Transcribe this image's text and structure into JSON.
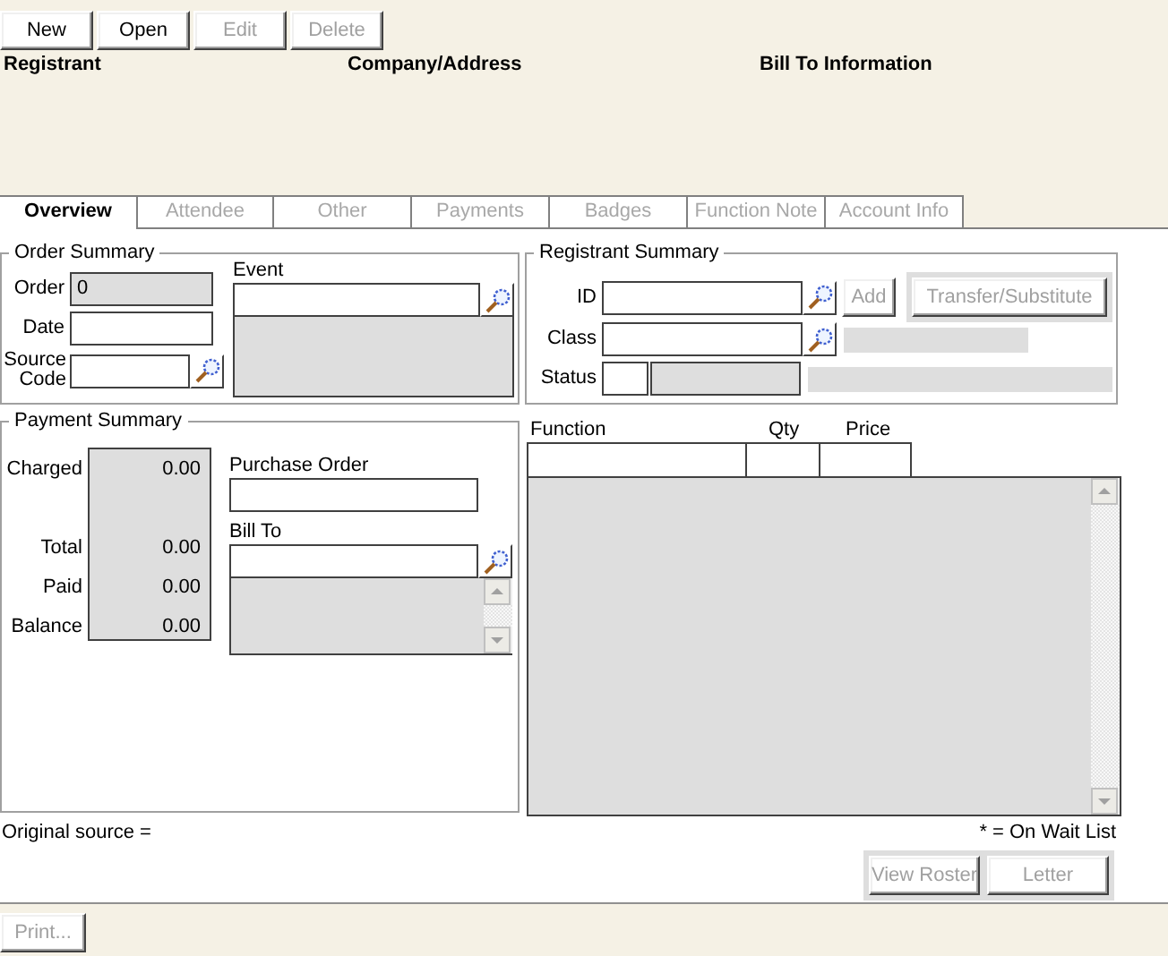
{
  "toolbar": [
    {
      "label": "New",
      "disabled": false
    },
    {
      "label": "Open",
      "disabled": false
    },
    {
      "label": "Edit",
      "disabled": true
    },
    {
      "label": "Delete",
      "disabled": true
    }
  ],
  "header_columns": [
    "Registrant",
    "Company/Address",
    "Bill To Information"
  ],
  "tabs": [
    {
      "label": "Overview",
      "selected": true,
      "disabled": false
    },
    {
      "label": "Attendee",
      "selected": false,
      "disabled": true
    },
    {
      "label": "Other",
      "selected": false,
      "disabled": true
    },
    {
      "label": "Payments",
      "selected": false,
      "disabled": true
    },
    {
      "label": "Badges",
      "selected": false,
      "disabled": true
    },
    {
      "label": "Function Note",
      "selected": false,
      "disabled": true
    },
    {
      "label": "Account Info",
      "selected": false,
      "disabled": true
    }
  ],
  "order_summary": {
    "title": "Order Summary",
    "order": {
      "label": "Order",
      "value": "0"
    },
    "date": {
      "label": "Date"
    },
    "source_code": {
      "label": "Source Code"
    },
    "event": {
      "label": "Event"
    }
  },
  "payment_summary": {
    "title": "Payment Summary",
    "rows": [
      {
        "label": "Charged",
        "value": "0.00"
      },
      {
        "label": "Total",
        "value": "0.00"
      },
      {
        "label": "Paid",
        "value": "0.00"
      },
      {
        "label": "Balance",
        "value": "0.00"
      }
    ],
    "purchase_order": {
      "label": "Purchase Order"
    },
    "bill_to": {
      "label": "Bill To"
    }
  },
  "registrant_summary": {
    "title": "Registrant Summary",
    "id": {
      "label": "ID"
    },
    "class": {
      "label": "Class"
    },
    "status": {
      "label": "Status"
    },
    "add_button": {
      "label": "Add",
      "disabled": true
    },
    "transfer_button": {
      "label": "Transfer/Substitute",
      "disabled": true
    }
  },
  "functions": {
    "columns": [
      "Function",
      "Qty",
      "Price"
    ]
  },
  "original_source": "Original source =",
  "wait_list_note": "* = On Wait List",
  "roster_buttons": [
    {
      "label": "View Roster",
      "disabled": true
    },
    {
      "label": "Letter",
      "disabled": true
    }
  ],
  "print_button": {
    "label": "Print...",
    "disabled": true
  }
}
